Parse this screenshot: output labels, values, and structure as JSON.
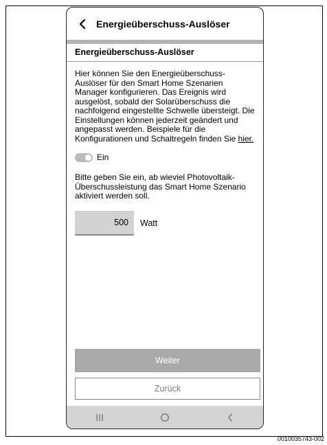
{
  "header": {
    "title": "Energieüberschuss-Auslöser",
    "back_icon": "chevron-left-icon"
  },
  "content": {
    "section_title": "Energieüberschuss-Auslöser",
    "description": "Hier können Sie den Energieüberschuss-Auslöser für den Smart Home Szenarien Manager konfigurieren. Das Ereignis wird ausgelöst, sobald der Solarüberschuss die nachfolgend eingestellte Schwelle übersteigt. Die Einstellungen können jederzeit geändert und angepasst werden. Beispiele für die Konfigurationen und Schaltregeln finden Sie ",
    "link_text": "hier.",
    "toggle_label": "Ein",
    "toggle_on": true,
    "instruction": "Bitte geben Sie ein, ab wieviel Photovoltaik-Überschussleistung das Smart Home Szenario aktiviert werden soll.",
    "watt_value": "500",
    "unit": "Watt"
  },
  "buttons": {
    "next": "Weiter",
    "back": "Zurück"
  },
  "navbar": {
    "icons": [
      "recent-apps-icon",
      "home-icon",
      "back-icon"
    ]
  },
  "doc_id": "0010035743-002",
  "colors": {
    "header_divider": "#b4b4b4",
    "input_bg": "#d2d2d2",
    "next_button_bg": "#a9a9a9",
    "navbar_bg": "#d4d4d4"
  }
}
